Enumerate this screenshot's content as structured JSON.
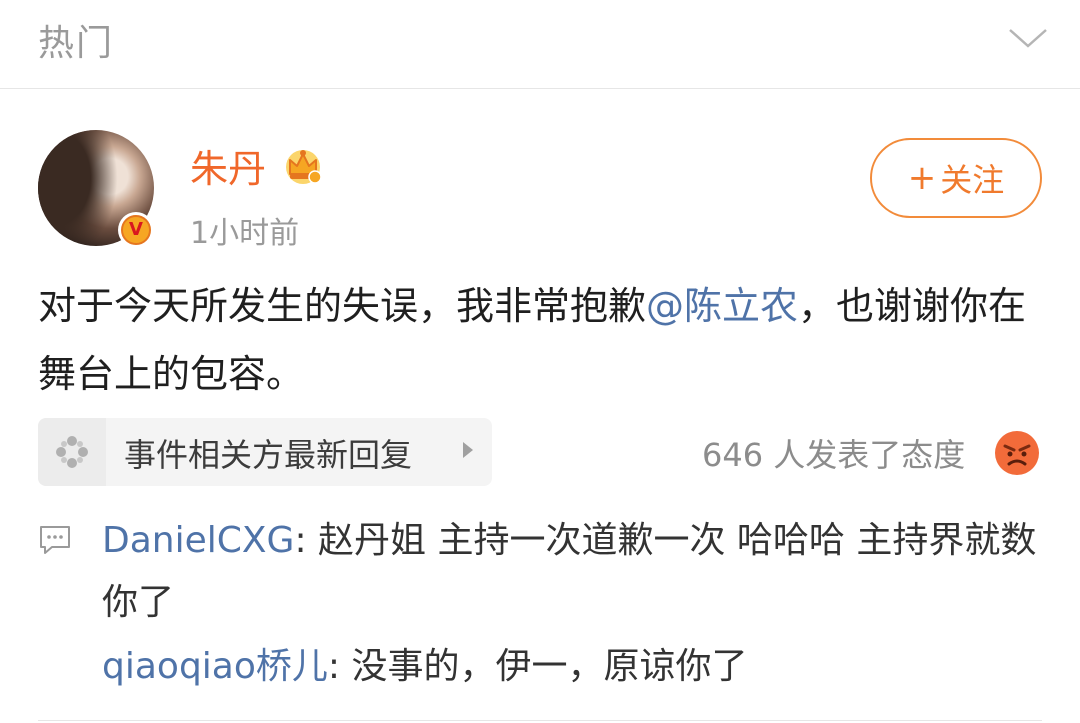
{
  "header": {
    "title": "热门",
    "chevron_icon": "chevron-down-icon"
  },
  "post": {
    "author": "朱丹",
    "author_badge_icon": "crown-icon",
    "verified_label": "V",
    "time": "1小时前",
    "follow_plus": "+",
    "follow_label": "关注",
    "text_part1": "对于今天所发生的失误，我非常抱歉",
    "mention": "@陈立农",
    "text_part2": "，也谢谢你在舞台上的包容。",
    "related_label": "事件相关方最新回复",
    "reactions_text": "646 人发表了态度",
    "reaction_icon": "angry-face-icon"
  },
  "comments": [
    {
      "author": "DanielCXG",
      "separator": ": ",
      "text": "赵丹姐  主持一次道歉一次  哈哈哈  主持界就数你了"
    },
    {
      "author": "qiaoqiao桥儿",
      "separator": ": ",
      "text": "没事的，伊一，原谅你了"
    }
  ],
  "colors": {
    "accent_orange": "#f0672a",
    "link_blue": "#4f73a8",
    "muted_gray": "#9a9a9a"
  }
}
